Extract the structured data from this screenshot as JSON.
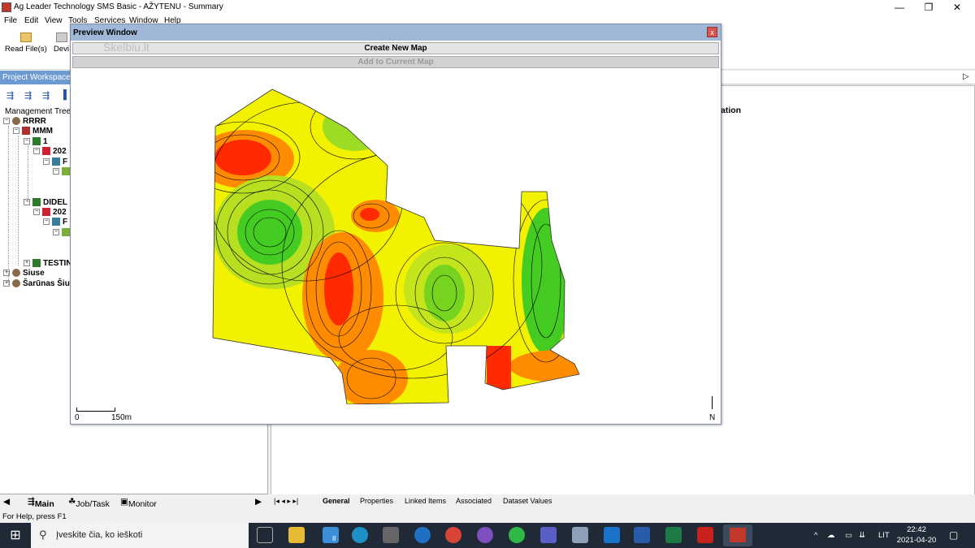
{
  "window": {
    "title": "Ag Leader Technology SMS Basic - AŽYTENU - Summary",
    "minimize": "—",
    "restore": "❐",
    "close": "✕"
  },
  "menu": [
    "File",
    "Edit",
    "View",
    "Tools",
    "Services",
    "Window",
    "Help"
  ],
  "toolbar": {
    "read_files": "Read File(s)",
    "devices": "Devi"
  },
  "project_workspace": {
    "header": "Project Workspace",
    "tree_label": "Management Tree",
    "items": [
      {
        "label": "RRRR"
      },
      {
        "label": "MMM"
      },
      {
        "label": "1"
      },
      {
        "label": "202"
      },
      {
        "label": "F"
      },
      {
        "label": "DIDEL"
      },
      {
        "label": "202"
      },
      {
        "label": "F"
      },
      {
        "label": "TESTIN"
      },
      {
        "label": "Siuse"
      },
      {
        "label": "Šarūnas Šiu"
      }
    ],
    "tabs": [
      "Main",
      "Job/Task",
      "Monitor"
    ]
  },
  "right_pane": {
    "heading": "ation",
    "tabs": [
      "General",
      "Properties",
      "Linked Items",
      "Associated",
      "Dataset Values"
    ]
  },
  "preview": {
    "title": "Preview Window",
    "close": "x",
    "create_button": "Create New Map",
    "add_button": "Add to Current Map",
    "watermark": "Skelbiu.lt",
    "scale_start": "0",
    "scale_end": "150m",
    "north": "N",
    "colors": {
      "red": "#ff2a00",
      "orange": "#ff8c00",
      "yellow": "#f2f200",
      "green": "#44cc22"
    }
  },
  "status": "For Help, press F1",
  "taskbar": {
    "search_placeholder": "Įveskite čia, ko ieškoti",
    "language": "LIT",
    "time": "22:42",
    "date": "2021-04-20",
    "badge": "8"
  }
}
